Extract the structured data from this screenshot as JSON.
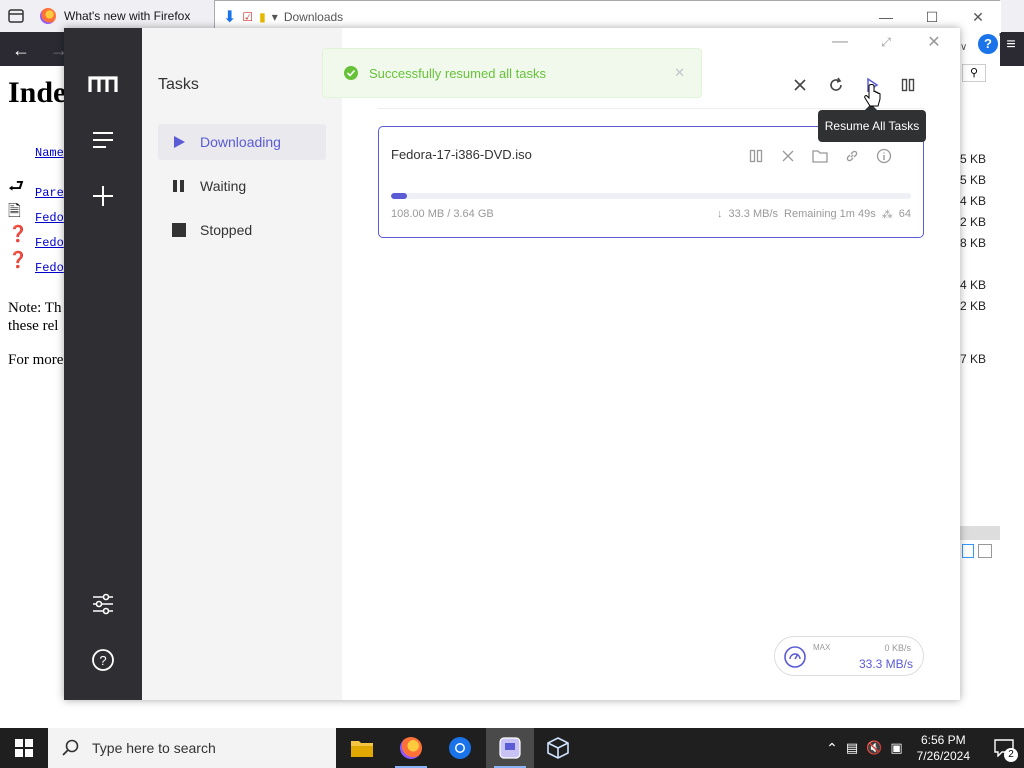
{
  "firefox": {
    "tab_title": "What's new with Firefox",
    "downloads_title": "Downloads",
    "page_heading": "Inde",
    "links": [
      "Name",
      "Pare",
      "Fedo",
      "Fedo",
      "Fedo"
    ],
    "note_1": "Note: Th",
    "note_2": "these rel",
    "note_3": "For more",
    "sizes": [
      "5 KB",
      "5 KB",
      "4 KB",
      "2 KB",
      "8 KB",
      "4 KB",
      "2 KB",
      "7 KB"
    ]
  },
  "motrix": {
    "subnav_title": "Tasks",
    "nav": [
      {
        "label": "Downloading",
        "icon": "play-icon",
        "active": true
      },
      {
        "label": "Waiting",
        "icon": "pause-icon",
        "active": false
      },
      {
        "label": "Stopped",
        "icon": "stop-icon",
        "active": false
      }
    ],
    "task": {
      "name": "Fedora-17-i386-DVD.iso",
      "progress": "108.00 MB / 3.64 GB",
      "progress_fraction": 0.03,
      "speed": "33.3 MB/s",
      "remaining": "Remaining 1m 49s",
      "connections": "64"
    },
    "speed": {
      "max_label": "MAX",
      "upload": "0 KB/s",
      "download": "33.3 MB/s"
    },
    "toast": "Successfully resumed all tasks",
    "tooltip": "Resume All Tasks",
    "accent": "#5b5bd6",
    "toast_color": "#67c23a"
  },
  "taskbar": {
    "search_placeholder": "Type here to search",
    "time": "6:56 PM",
    "date": "7/26/2024",
    "notification_count": "2"
  }
}
